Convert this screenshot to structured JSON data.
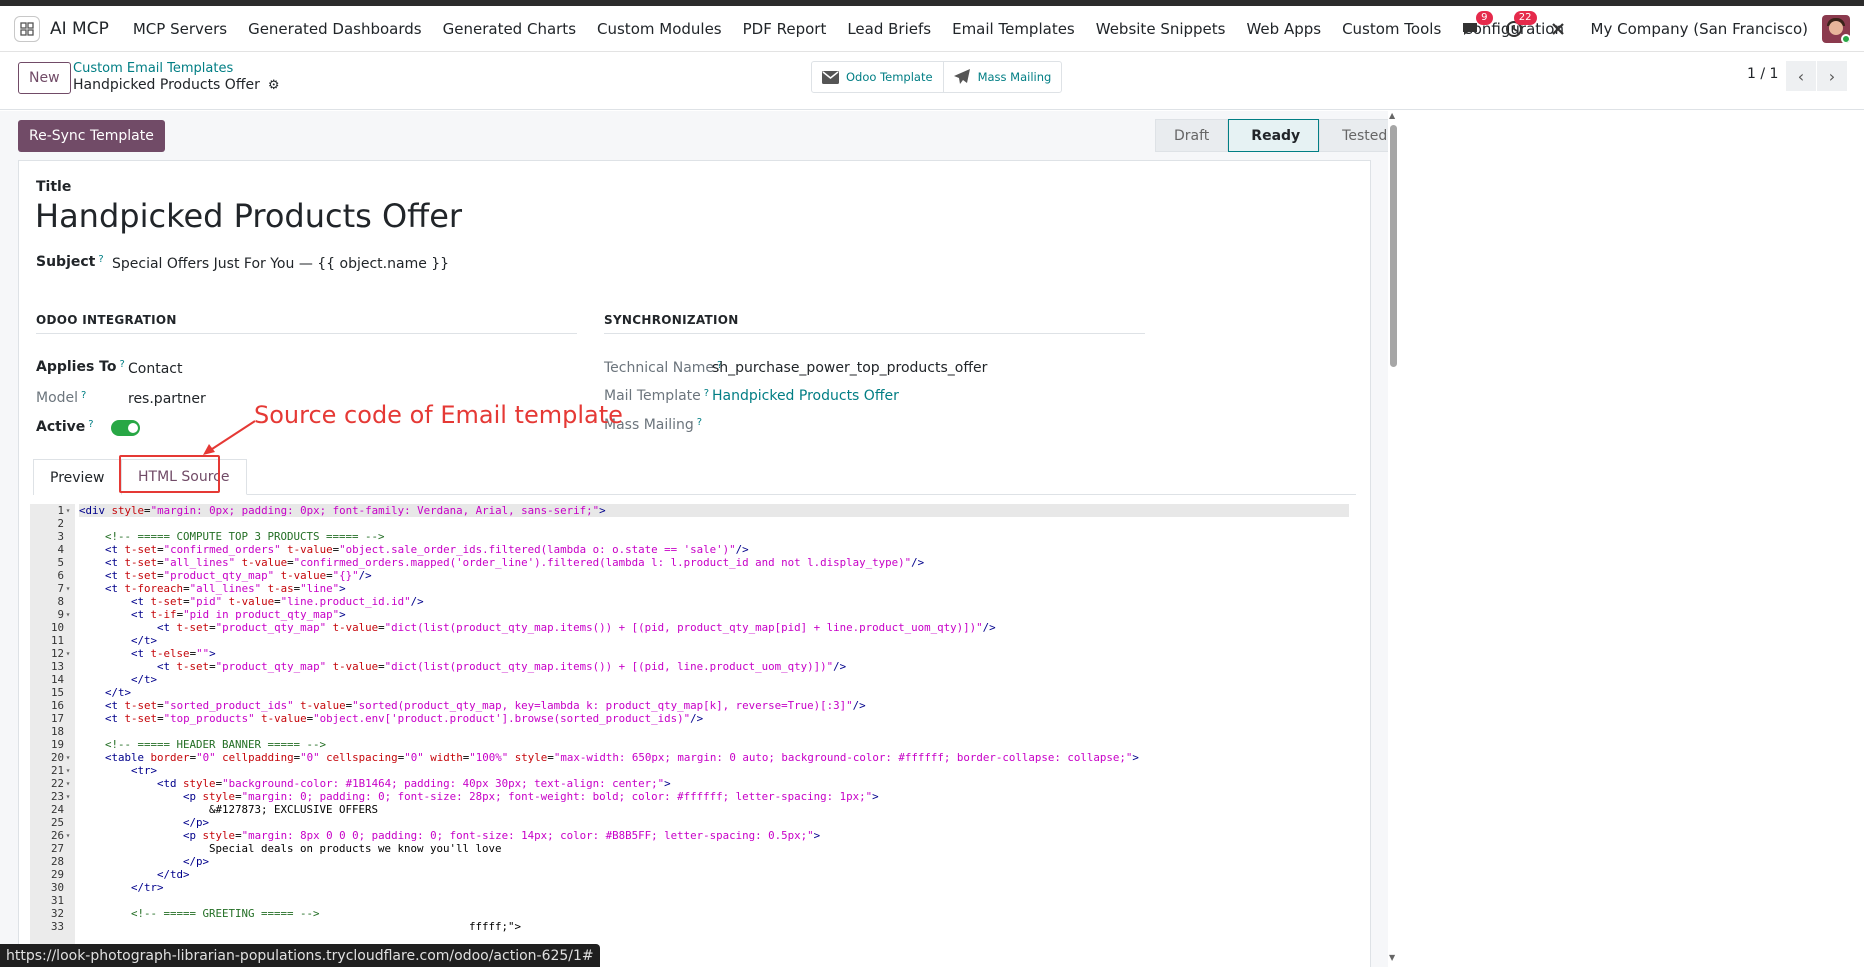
{
  "navbar": {
    "brand": "AI MCP",
    "menu": [
      "MCP Servers",
      "Generated Dashboards",
      "Generated Charts",
      "Custom Modules",
      "PDF Report",
      "Lead Briefs",
      "Email Templates",
      "Website Snippets",
      "Web Apps",
      "Custom Tools",
      "Configuration"
    ],
    "messages_badge": "9",
    "activity_badge": "22",
    "company": "My Company (San Francisco)"
  },
  "control_panel": {
    "new_label": "New",
    "breadcrumb_parent": "Custom Email Templates",
    "breadcrumb_current": "Handpicked Products Offer",
    "smart_buttons": {
      "odoo_template": "Odoo Template",
      "mass_mailing": "Mass Mailing"
    },
    "pager": "1 / 1"
  },
  "header": {
    "resync_label": "Re-Sync Template",
    "stages": [
      "Draft",
      "Ready",
      "Tested"
    ],
    "active_stage": "Ready"
  },
  "form": {
    "title_label": "Title",
    "title": "Handpicked Products Offer",
    "subject_label": "Subject",
    "subject": "Special Offers Just For You — {{ object.name }}",
    "help_mark": "?",
    "odoo_integration": {
      "heading": "ODOO INTEGRATION",
      "applies_to_label": "Applies To",
      "applies_to": "Contact",
      "model_label": "Model",
      "model": "res.partner",
      "active_label": "Active",
      "active": true
    },
    "synchronization": {
      "heading": "SYNCHRONIZATION",
      "technical_name_label": "Technical Name",
      "technical_name": "sh_purchase_power_top_products_offer",
      "mail_template_label": "Mail Template",
      "mail_template": "Handpicked Products Offer",
      "mass_mailing_label": "Mass Mailing"
    },
    "tabs": [
      "Preview",
      "HTML Source"
    ],
    "active_tab": "HTML Source"
  },
  "annotation": {
    "callout": "Source code of Email template",
    "color": "#e53935"
  },
  "editor": {
    "lines": [
      "<div style=\"margin: 0px; padding: 0px; font-family: Verdana, Arial, sans-serif;\">",
      "",
      "    <!-- ===== COMPUTE TOP 3 PRODUCTS ===== -->",
      "    <t t-set=\"confirmed_orders\" t-value=\"object.sale_order_ids.filtered(lambda o: o.state == 'sale')\"/>",
      "    <t t-set=\"all_lines\" t-value=\"confirmed_orders.mapped('order_line').filtered(lambda l: l.product_id and not l.display_type)\"/>",
      "    <t t-set=\"product_qty_map\" t-value=\"{}\"/>",
      "    <t t-foreach=\"all_lines\" t-as=\"line\">",
      "        <t t-set=\"pid\" t-value=\"line.product_id.id\"/>",
      "        <t t-if=\"pid in product_qty_map\">",
      "            <t t-set=\"product_qty_map\" t-value=\"dict(list(product_qty_map.items()) + [(pid, product_qty_map[pid] + line.product_uom_qty)])\"/>",
      "        </t>",
      "        <t t-else=\"\">",
      "            <t t-set=\"product_qty_map\" t-value=\"dict(list(product_qty_map.items()) + [(pid, line.product_uom_qty)])\"/>",
      "        </t>",
      "    </t>",
      "    <t t-set=\"sorted_product_ids\" t-value=\"sorted(product_qty_map, key=lambda k: product_qty_map[k], reverse=True)[:3]\"/>",
      "    <t t-set=\"top_products\" t-value=\"object.env['product.product'].browse(sorted_product_ids)\"/>",
      "",
      "    <!-- ===== HEADER BANNER ===== -->",
      "    <table border=\"0\" cellpadding=\"0\" cellspacing=\"0\" width=\"100%\" style=\"max-width: 650px; margin: 0 auto; background-color: #ffffff; border-collapse: collapse;\">",
      "        <tr>",
      "            <td style=\"background-color: #1B1464; padding: 40px 30px; text-align: center;\">",
      "                <p style=\"margin: 0; padding: 0; font-size: 28px; font-weight: bold; color: #ffffff; letter-spacing: 1px;\">",
      "                    &#127873; EXCLUSIVE OFFERS",
      "                </p>",
      "                <p style=\"margin: 8px 0 0 0; padding: 0; font-size: 14px; color: #B8B5FF; letter-spacing: 0.5px;\">",
      "                    Special deals on products we know you'll love",
      "                </p>",
      "            </td>",
      "        </tr>",
      "",
      "        <!-- ===== GREETING ===== -->",
      "                                                            fffff;\">"
    ],
    "fold_lines": [
      1,
      7,
      9,
      12,
      20,
      21,
      22,
      23,
      26
    ]
  },
  "status_url": "https://look-photograph-librarian-populations.trycloudflare.com/odoo/action-625/1#"
}
